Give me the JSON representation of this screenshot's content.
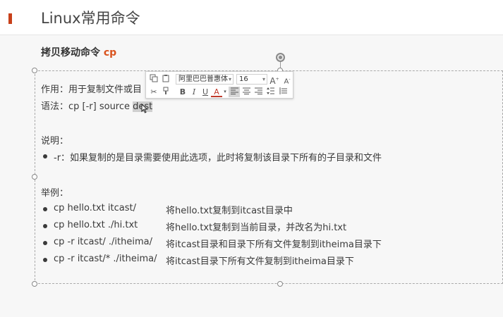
{
  "slide": {
    "title": "Linux常用命令",
    "subtitle_prefix": "拷贝移动命令 ",
    "subtitle_cmd": "cp"
  },
  "content": {
    "purpose": "作用：用于复制文件或目",
    "syntax_prefix": "语法：cp [-r] source ",
    "syntax_selected": "dest",
    "notes_label": "说明：",
    "note_item": "-r：如果复制的是目录需要使用此选项，此时将复制该目录下所有的子目录和文件",
    "examples_label": "举例：",
    "examples": [
      {
        "cmd": "cp hello.txt itcast/",
        "desc": "将hello.txt复制到itcast目录中"
      },
      {
        "cmd": "cp hello.txt ./hi.txt",
        "desc": "将hello.txt复制到当前目录，并改名为hi.txt"
      },
      {
        "cmd": "cp -r itcast/ ./itheima/",
        "desc": "将itcast目录和目录下所有文件复制到itheima目录下"
      },
      {
        "cmd": "cp -r itcast/* ./itheima/",
        "desc": "将itcast目录下所有文件复制到itheima目录下"
      }
    ]
  },
  "toolbar": {
    "font_name": "阿里巴巴普惠体",
    "font_size": "16",
    "grow_font": "A",
    "shrink_font": "A",
    "bold": "B",
    "italic": "I",
    "underline": "U",
    "font_color": "A"
  },
  "colors": {
    "accent": "#c8401a",
    "command_highlight": "#d9531e"
  }
}
